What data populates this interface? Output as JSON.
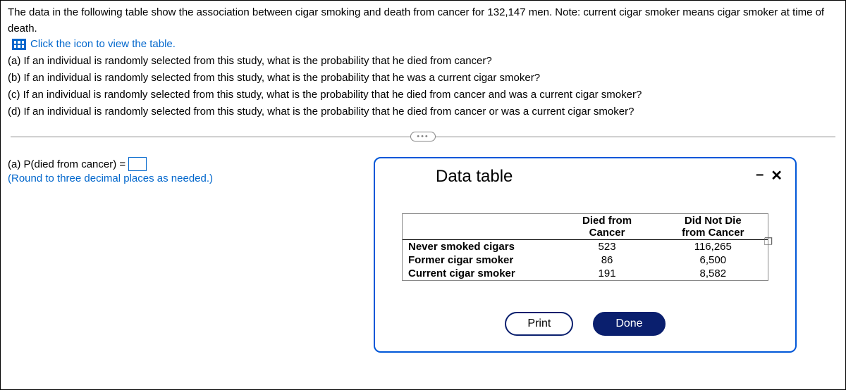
{
  "intro": "The data in the following table show the association between cigar smoking and death from cancer for 132,147 men. Note: current cigar smoker means cigar smoker at time of death.",
  "view_table_link": "Click the icon to view the table.",
  "questions": {
    "a": "(a) If an individual is randomly selected from this study, what is the probability that he died from cancer?",
    "b": "(b) If an individual is randomly selected from this study, what is the probability that he was a current cigar smoker?",
    "c": "(c) If an individual is randomly selected from this study, what is the probability that he died from cancer and was a current cigar smoker?",
    "d": "(d) If an individual is randomly selected from this study, what is the probability that he died from cancer or was a current cigar smoker?"
  },
  "answer": {
    "label_prefix": "(a) P(died from cancer) =",
    "value": "",
    "round_note": "(Round to three decimal places as needed.)"
  },
  "modal": {
    "title": "Data table",
    "minimize": "–",
    "close": "✕",
    "col1": "",
    "col2_line1": "Died from",
    "col2_line2": "Cancer",
    "col3_line1": "Did Not Die",
    "col3_line2": "from Cancer",
    "rows": [
      {
        "label": "Never smoked cigars",
        "died": "523",
        "not": "116,265"
      },
      {
        "label": "Former cigar smoker",
        "died": "86",
        "not": "6,500"
      },
      {
        "label": "Current cigar smoker",
        "died": "191",
        "not": "8,582"
      }
    ],
    "print": "Print",
    "done": "Done"
  },
  "chart_data": {
    "type": "table",
    "columns": [
      "",
      "Died from Cancer",
      "Did Not Die from Cancer"
    ],
    "rows": [
      [
        "Never smoked cigars",
        523,
        116265
      ],
      [
        "Former cigar smoker",
        86,
        6500
      ],
      [
        "Current cigar smoker",
        191,
        8582
      ]
    ],
    "total_men": 132147
  }
}
